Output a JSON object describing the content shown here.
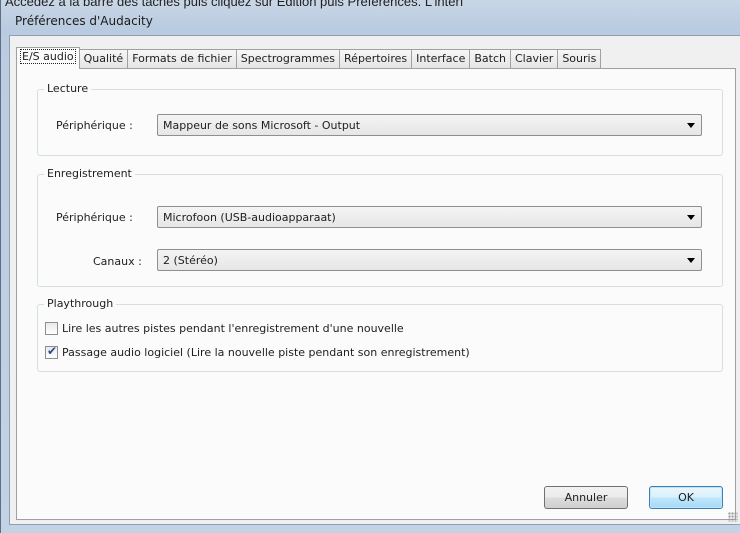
{
  "caption": "Accédez à la barre des tâches puis cliquez sur Edition puis Préférences. L'interf",
  "window": {
    "title": "Préférences d'Audacity"
  },
  "tabs": [
    {
      "label": "E/S audio",
      "active": true
    },
    {
      "label": "Qualité"
    },
    {
      "label": "Formats de fichier"
    },
    {
      "label": "Spectrogrammes"
    },
    {
      "label": "Répertoires"
    },
    {
      "label": "Interface"
    },
    {
      "label": "Batch"
    },
    {
      "label": "Clavier"
    },
    {
      "label": "Souris"
    }
  ],
  "lecture": {
    "title": "Lecture",
    "device_label": "Périphérique :",
    "device_value": "Mappeur de sons Microsoft - Output"
  },
  "enregistrement": {
    "title": "Enregistrement",
    "device_label": "Périphérique :",
    "device_value": "Microfoon (USB-audioapparaat)",
    "channels_label": "Canaux :",
    "channels_value": "2 (Stéréo)"
  },
  "playthrough": {
    "title": "Playthrough",
    "option1": {
      "label": "Lire les autres pistes pendant l'enregistrement d'une nouvelle",
      "checked": false
    },
    "option2": {
      "label": "Passage audio logiciel (Lire la nouvelle piste pendant son enregistrement)",
      "checked": true
    }
  },
  "buttons": {
    "cancel": "Annuler",
    "ok": "OK"
  },
  "icons": {
    "dropdown": "chevron-down-icon",
    "check": "checkmark-icon",
    "grip": "resize-grip-icon"
  }
}
